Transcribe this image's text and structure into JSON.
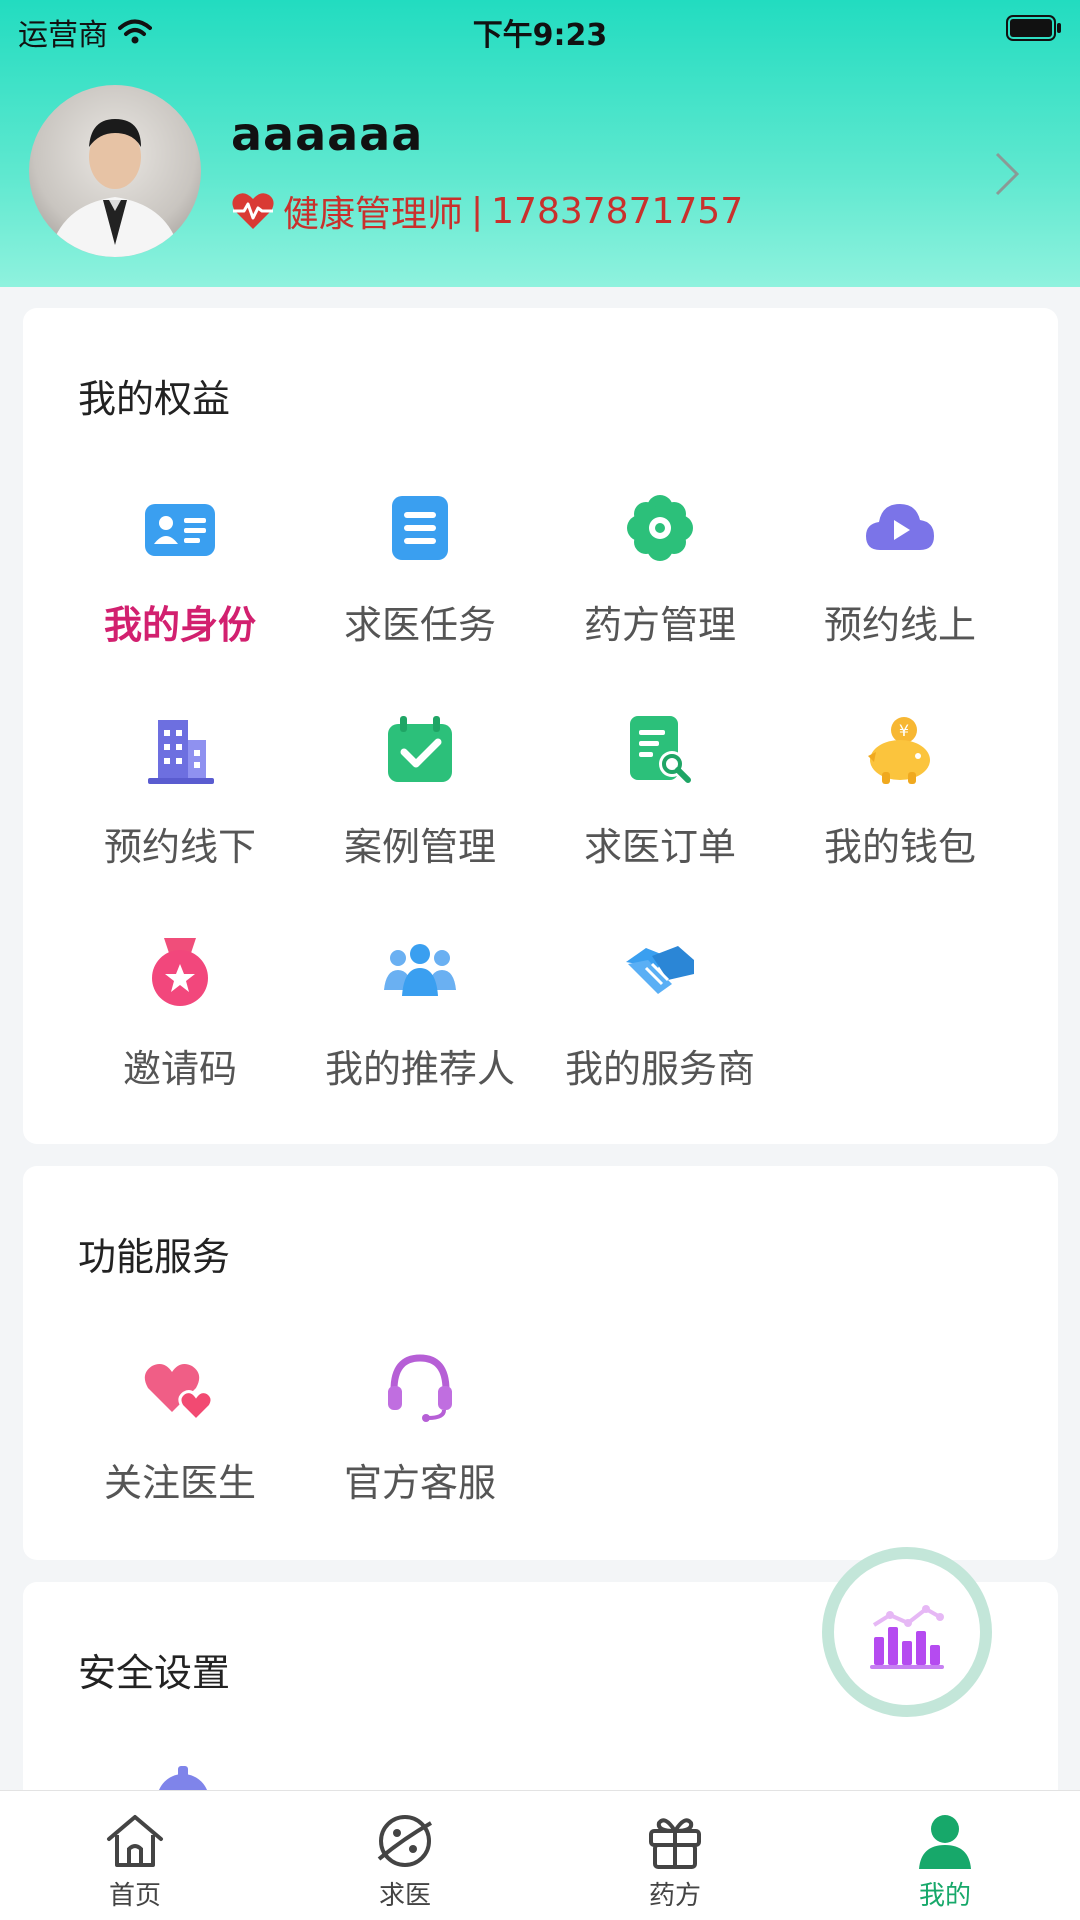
{
  "status_bar": {
    "carrier": "运营商",
    "time": "下午9:23"
  },
  "profile": {
    "name": "aaaaaa",
    "role": "健康管理师",
    "separator": "|",
    "phone": "17837871757"
  },
  "rights": {
    "title": "我的权益",
    "items": [
      {
        "label": "我的身份",
        "icon": "id-card-icon"
      },
      {
        "label": "求医任务",
        "icon": "task-list-icon"
      },
      {
        "label": "药方管理",
        "icon": "flower-icon"
      },
      {
        "label": "预约线上",
        "icon": "cloud-play-icon"
      },
      {
        "label": "预约线下",
        "icon": "building-icon"
      },
      {
        "label": "案例管理",
        "icon": "calendar-check-icon"
      },
      {
        "label": "求医订单",
        "icon": "document-search-icon"
      },
      {
        "label": "我的钱包",
        "icon": "piggy-bank-icon"
      },
      {
        "label": "邀请码",
        "icon": "medal-star-icon"
      },
      {
        "label": "我的推荐人",
        "icon": "people-group-icon"
      },
      {
        "label": "我的服务商",
        "icon": "handshake-icon"
      }
    ]
  },
  "services": {
    "title": "功能服务",
    "items": [
      {
        "label": "关注医生",
        "icon": "hearts-icon"
      },
      {
        "label": "官方客服",
        "icon": "headset-icon"
      }
    ]
  },
  "security": {
    "title": "安全设置",
    "icon": "settings-gear-icon"
  },
  "floating_button": {
    "icon": "bar-chart-icon"
  },
  "tabbar": {
    "items": [
      {
        "label": "首页",
        "icon": "home-icon"
      },
      {
        "label": "求医",
        "icon": "planet-icon"
      },
      {
        "label": "药方",
        "icon": "gift-box-icon"
      },
      {
        "label": "我的",
        "icon": "user-icon"
      }
    ],
    "active": "我的"
  },
  "colors": {
    "accent": "#17a86a",
    "header_top": "#22dcc0",
    "header_bottom": "#8ff2de",
    "active_label": "#d2206f",
    "role_text": "#c9302c"
  }
}
